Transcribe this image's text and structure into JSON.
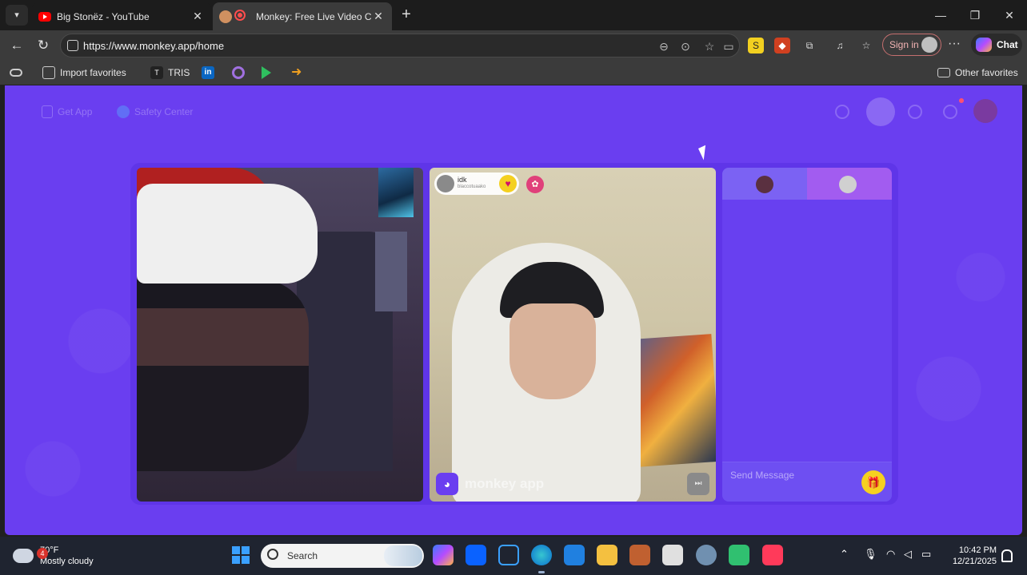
{
  "browser": {
    "tabs": [
      {
        "title": "Big Stonëz - YouTube",
        "favicon": "youtube-icon",
        "active": false
      },
      {
        "title": "Monkey: Free Live Video Chat",
        "favicon": "monkey-icon",
        "active": true,
        "recording": true
      }
    ],
    "url": "https://www.monkey.app/home",
    "signin_label": "Sign in",
    "copilot_label": "Chat",
    "favorites": {
      "import_label": "Import favorites",
      "items": [
        {
          "label": "TRIS",
          "icon": "tris-icon"
        },
        {
          "label": "",
          "icon": "linkedin-icon"
        },
        {
          "label": "",
          "icon": "circle-icon"
        },
        {
          "label": "",
          "icon": "play-store-icon"
        },
        {
          "label": "",
          "icon": "arrow-icon"
        }
      ],
      "other_label": "Other favorites"
    }
  },
  "page": {
    "nav": {
      "get_app": "Get App",
      "safety_center": "Safety Center"
    },
    "remote_user": {
      "name": "idk",
      "handle": "blaccotuaako"
    },
    "brand_text": "monkey app",
    "chat": {
      "placeholder": "Send Message"
    },
    "accent": "#6a3ef0"
  },
  "taskbar": {
    "weather": {
      "temp": "70°F",
      "condition": "Mostly cloudy",
      "badge": "4"
    },
    "search_label": "Search",
    "time": "10:42 PM",
    "date": "12/21/2025"
  }
}
